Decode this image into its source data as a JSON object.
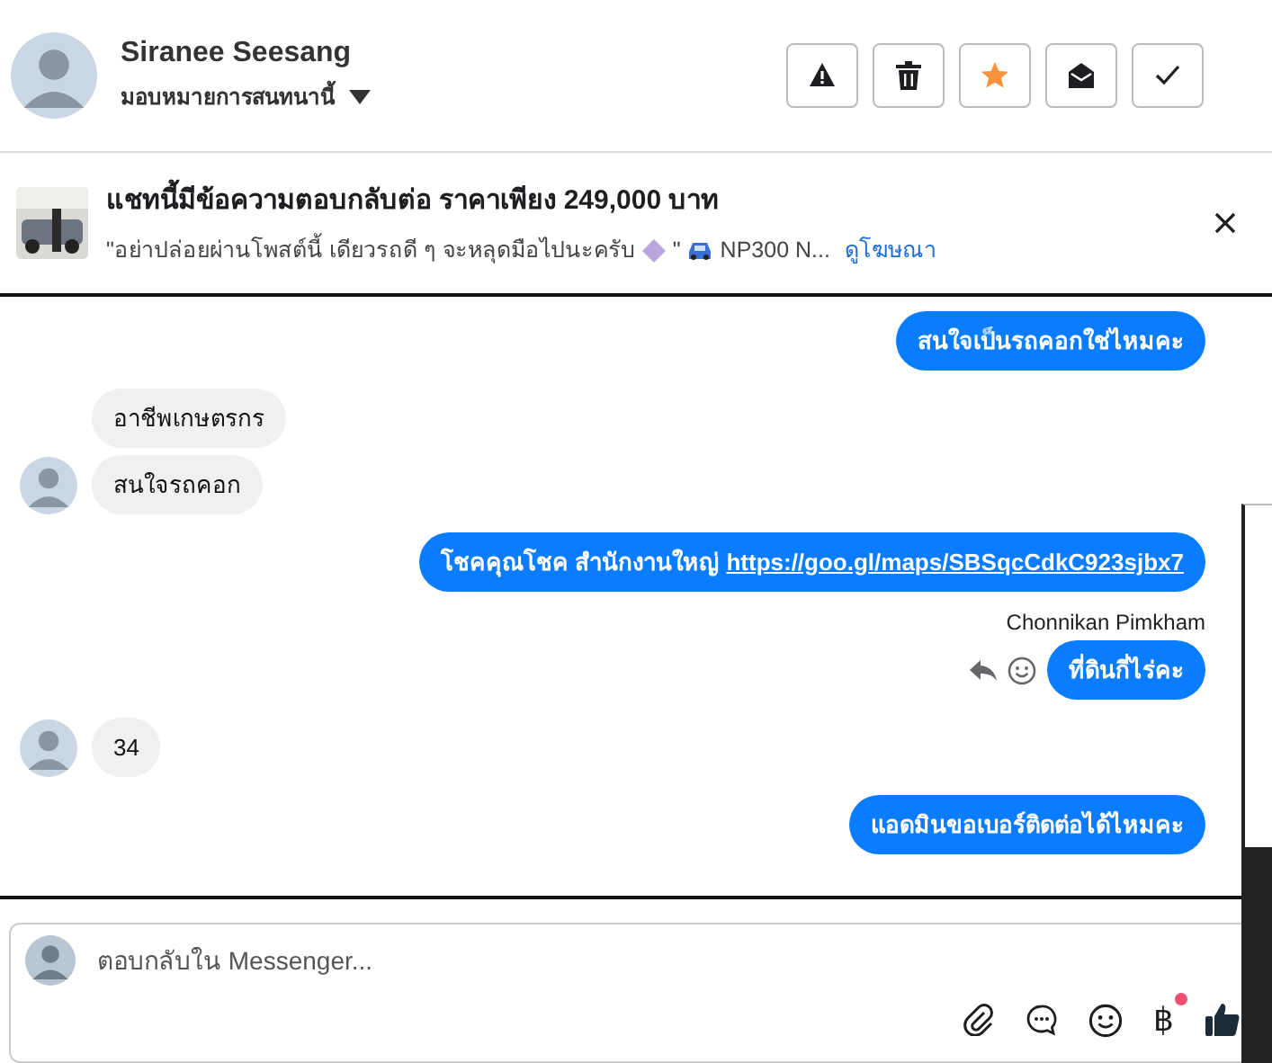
{
  "header": {
    "name": "Siranee Seesang",
    "assign_label": "มอบหมายการสนทนานี้",
    "actions": [
      {
        "kind": "alert",
        "color": "#1c1e21"
      },
      {
        "kind": "delete",
        "color": "#1c1e21"
      },
      {
        "kind": "star",
        "color": "#f7923a"
      },
      {
        "kind": "unread",
        "color": "#1c1e21"
      },
      {
        "kind": "done",
        "color": "#1c1e21"
      }
    ]
  },
  "ad": {
    "title": "แชทนี้มีข้อความตอบกลับต่อ ราคาเพียง 249,000 บาท",
    "quote": "\"อย่าปล่อยผ่านโพสต์นี้ เดียวรถดี ๆ จะหลุดมือไปนะครับ",
    "quote_end": "\"",
    "product": "NP300 N...",
    "link": "ดูโฆษณา"
  },
  "messages": [
    {
      "kind": "sent",
      "text": "สนใจเป็นรถคอกใช่ไหมคะ"
    },
    {
      "kind": "received",
      "text": "อาชีพเกษตรกร",
      "avatar": false
    },
    {
      "kind": "received",
      "text": "สนใจรถคอก",
      "avatar": true
    },
    {
      "kind": "sent",
      "text": "โชคคุณโชค สำนักงานใหญ่",
      "link": "https://goo.gl/maps/SBSqcCdkC923sjbx7"
    },
    {
      "kind": "sent",
      "sender": "Chonnikan Pimkham",
      "text": "ที่ดินกี่ไร่คะ",
      "hovered": true
    },
    {
      "kind": "received",
      "text": "34",
      "avatar": true
    },
    {
      "kind": "sent",
      "text": "แอดมินขอเบอร์ติดต่อได้ไหมคะ"
    }
  ],
  "composer": {
    "placeholder": "ตอบกลับใน Messenger...",
    "currency_symbol": "฿",
    "currency_badge": true
  }
}
